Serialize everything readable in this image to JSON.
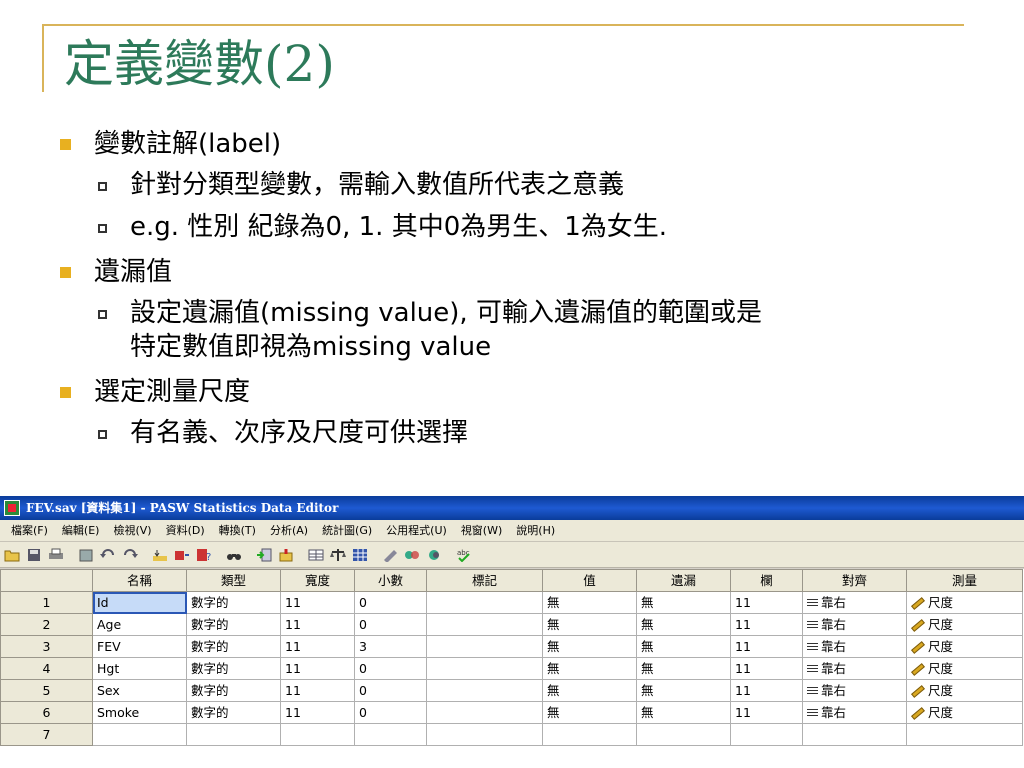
{
  "slide": {
    "title": "定義變數(2)",
    "bullets": [
      {
        "text": "變數註解(label)",
        "subs": [
          "針對分類型變數，需輸入數值所代表之意義",
          "e.g. 性別 紀錄為0, 1. 其中0為男生、1為女生."
        ]
      },
      {
        "text": "遺漏值",
        "subs": [
          "設定遺漏值(missing value), 可輸入遺漏值的範圍或是",
          "特定數值即視為missing value"
        ]
      },
      {
        "text": "選定測量尺度",
        "subs": [
          "有名義、次序及尺度可供選擇"
        ]
      }
    ],
    "accent_color": "#2d7a5a",
    "bullet_color": "#e8b020"
  },
  "spss": {
    "title": "FEV.sav [資料集1] - PASW Statistics Data Editor",
    "menu": [
      "檔案(F)",
      "編輯(E)",
      "檢視(V)",
      "資料(D)",
      "轉換(T)",
      "分析(A)",
      "統計圖(G)",
      "公用程式(U)",
      "視窗(W)",
      "說明(H)"
    ],
    "toolbar_icons": [
      "open-icon",
      "save-icon",
      "print-icon",
      "dialog-recall-icon",
      "undo-icon",
      "redo-icon",
      "goto-case-icon",
      "goto-variable-icon",
      "variables-icon",
      "find-icon",
      "insert-cases-icon",
      "insert-variable-icon",
      "split-file-icon",
      "weight-cases-icon",
      "select-cases-icon",
      "value-labels-icon",
      "use-sets-icon",
      "show-all-icon",
      "spell-check-icon"
    ],
    "columns": [
      "名稱",
      "類型",
      "寬度",
      "小數",
      "標記",
      "值",
      "遺漏",
      "欄",
      "對齊",
      "測量"
    ],
    "rows": [
      {
        "num": "1",
        "name": "Id",
        "type": "數字的",
        "width": "11",
        "decimals": "0",
        "label": "",
        "values": "無",
        "missing": "無",
        "cols": "11",
        "align": "靠右",
        "measure": "尺度"
      },
      {
        "num": "2",
        "name": "Age",
        "type": "數字的",
        "width": "11",
        "decimals": "0",
        "label": "",
        "values": "無",
        "missing": "無",
        "cols": "11",
        "align": "靠右",
        "measure": "尺度"
      },
      {
        "num": "3",
        "name": "FEV",
        "type": "數字的",
        "width": "11",
        "decimals": "3",
        "label": "",
        "values": "無",
        "missing": "無",
        "cols": "11",
        "align": "靠右",
        "measure": "尺度"
      },
      {
        "num": "4",
        "name": "Hgt",
        "type": "數字的",
        "width": "11",
        "decimals": "0",
        "label": "",
        "values": "無",
        "missing": "無",
        "cols": "11",
        "align": "靠右",
        "measure": "尺度"
      },
      {
        "num": "5",
        "name": "Sex",
        "type": "數字的",
        "width": "11",
        "decimals": "0",
        "label": "",
        "values": "無",
        "missing": "無",
        "cols": "11",
        "align": "靠右",
        "measure": "尺度"
      },
      {
        "num": "6",
        "name": "Smoke",
        "type": "數字的",
        "width": "11",
        "decimals": "0",
        "label": "",
        "values": "無",
        "missing": "無",
        "cols": "11",
        "align": "靠右",
        "measure": "尺度"
      },
      {
        "num": "7",
        "name": "",
        "type": "",
        "width": "",
        "decimals": "",
        "label": "",
        "values": "",
        "missing": "",
        "cols": "",
        "align": "",
        "measure": ""
      }
    ]
  }
}
